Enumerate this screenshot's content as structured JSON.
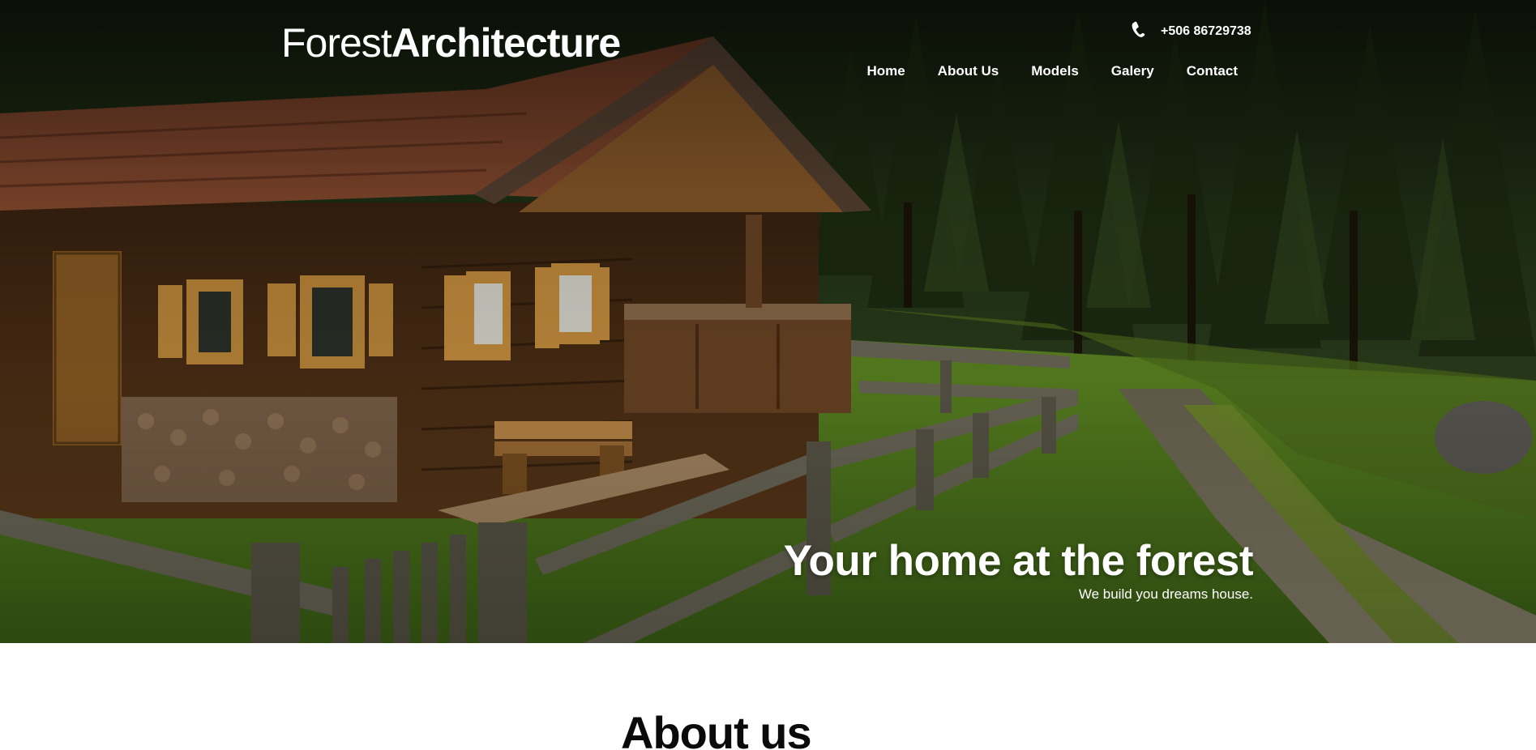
{
  "brand": {
    "light": "Forest",
    "bold": "Architecture"
  },
  "contact": {
    "phone": "+506 86729738",
    "icon": "phone-icon"
  },
  "nav": {
    "items": [
      {
        "label": "Home"
      },
      {
        "label": "About Us"
      },
      {
        "label": "Models"
      },
      {
        "label": "Galery"
      },
      {
        "label": "Contact"
      }
    ]
  },
  "hero": {
    "title": "Your home at the forest",
    "subtitle": "We build you dreams house."
  },
  "about": {
    "heading": "About us"
  },
  "colors": {
    "text_light": "#ffffff",
    "heading_dark": "#0a0a0a",
    "page_bg": "#ffffff"
  }
}
